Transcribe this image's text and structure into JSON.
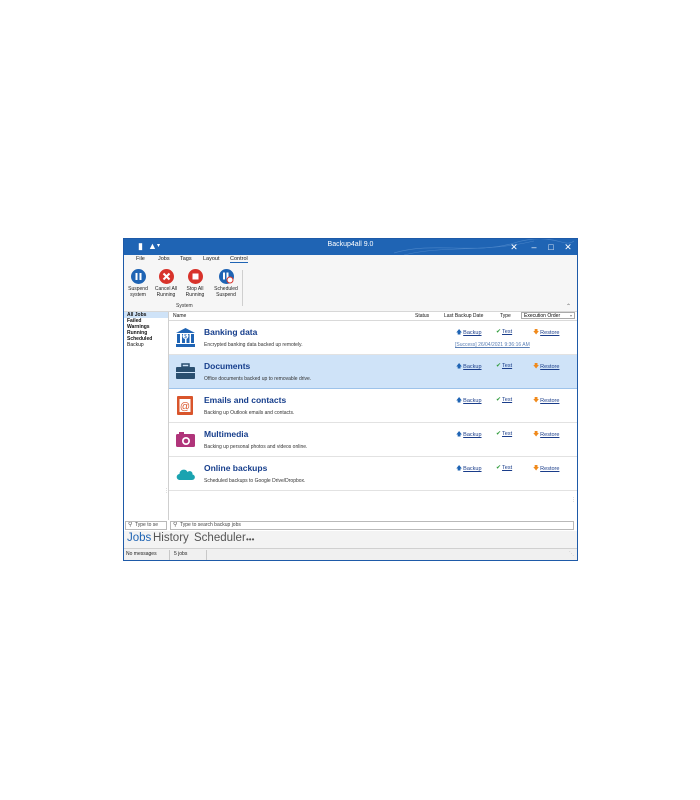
{
  "window": {
    "title": "Backup4all 9.0"
  },
  "menu": {
    "items": [
      "File",
      "Jobs",
      "Tags",
      "Layout",
      "Control"
    ],
    "active": "Control"
  },
  "ribbon": {
    "buttons": [
      {
        "l1": "Suspend",
        "l2": "system",
        "icon": "suspend-icon",
        "color": "#1f64b4"
      },
      {
        "l1": "Cancel All",
        "l2": "Running",
        "icon": "cancel-icon",
        "color": "#d8332b"
      },
      {
        "l1": "Stop All",
        "l2": "Running",
        "icon": "stop-icon",
        "color": "#d8332b"
      },
      {
        "l1": "Scheduled",
        "l2": "Suspend",
        "icon": "scheduled-suspend-icon",
        "color": "#1f64b4"
      }
    ],
    "group_label": "System"
  },
  "sidebar": {
    "items": [
      "All Jobs",
      "Failed",
      "Warnings",
      "Running",
      "Scheduled",
      "Backup"
    ],
    "search_placeholder": "Type to se"
  },
  "columns": {
    "name": "Name",
    "status": "Status",
    "last_backup": "Last Backup Date",
    "type": "Type",
    "execution_order": "Execution Order"
  },
  "actions": {
    "backup": "Backup",
    "test": "Test",
    "restore": "Restore"
  },
  "jobs": [
    {
      "name": "Banking data",
      "desc": "Encrypted banking data backed up remotely.",
      "status": "[Success] 26/04/2021 9:36:16 AM",
      "icon": "bank-icon",
      "color": "#1f64b4"
    },
    {
      "name": "Documents",
      "desc": "Office documents backed up to removable drive.",
      "status": "",
      "icon": "briefcase-icon",
      "color": "#2a4f70"
    },
    {
      "name": "Emails and contacts",
      "desc": "Backing up Outlook emails and contacts.",
      "status": "",
      "icon": "email-icon",
      "color": "#d9552b"
    },
    {
      "name": "Multimedia",
      "desc": "Backing up personal photos and videos online.",
      "status": "",
      "icon": "camera-icon",
      "color": "#b0347a"
    },
    {
      "name": "Online backups",
      "desc": "Scheduled backups to Google Drive/Dropbox.",
      "status": "",
      "icon": "cloud-icon",
      "color": "#1aa3b0"
    }
  ],
  "search": {
    "placeholder": "Type to search backup jobs"
  },
  "bottom_nav": {
    "tabs": [
      "Jobs",
      "History",
      "Scheduler"
    ],
    "more": "•••"
  },
  "statusbar": {
    "messages": "No messages",
    "count": "5 jobs"
  }
}
